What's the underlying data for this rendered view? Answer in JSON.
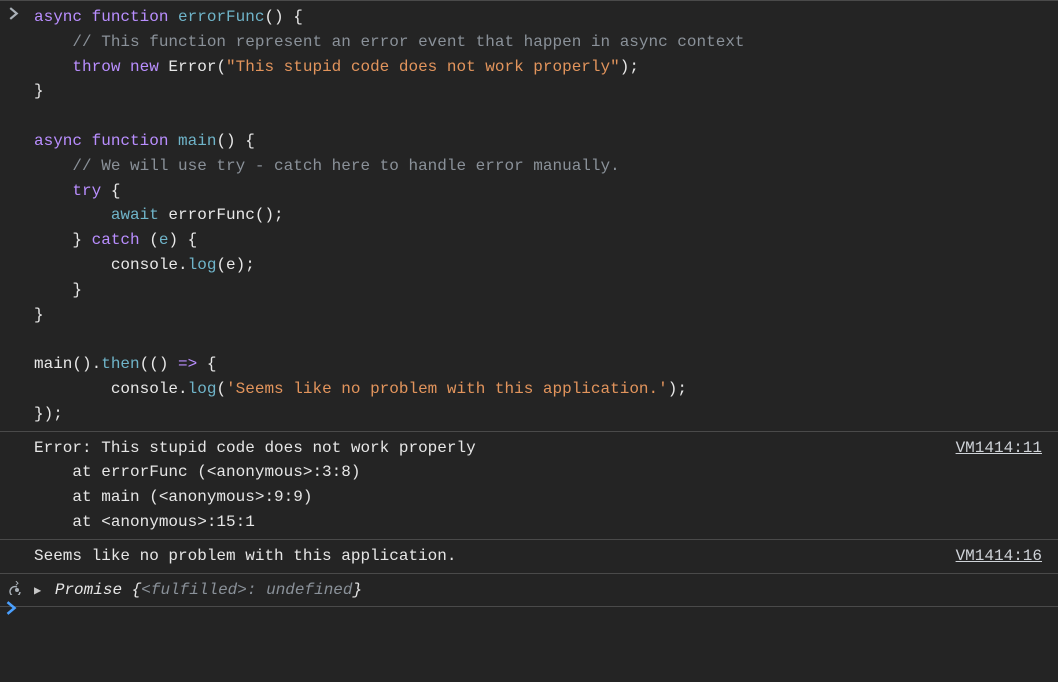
{
  "input": {
    "prompt_icon": "chevron-right",
    "tokens": [
      {
        "t": "async ",
        "c": "kw"
      },
      {
        "t": "function ",
        "c": "kw"
      },
      {
        "t": "errorFunc",
        "c": "fn"
      },
      {
        "t": "() {",
        "c": "plain"
      },
      {
        "t": "\n",
        "c": "nl"
      },
      {
        "t": "    // This function represent an error event that happen in async context",
        "c": "cmt"
      },
      {
        "t": "\n",
        "c": "nl"
      },
      {
        "t": "    ",
        "c": "plain"
      },
      {
        "t": "throw ",
        "c": "kw"
      },
      {
        "t": "new ",
        "c": "kw"
      },
      {
        "t": "Error",
        "c": "type"
      },
      {
        "t": "(",
        "c": "plain"
      },
      {
        "t": "\"This stupid code does not work properly\"",
        "c": "str"
      },
      {
        "t": ");",
        "c": "plain"
      },
      {
        "t": "\n",
        "c": "nl"
      },
      {
        "t": "}",
        "c": "plain"
      },
      {
        "t": "\n",
        "c": "nl"
      },
      {
        "t": "\n",
        "c": "nl"
      },
      {
        "t": "async ",
        "c": "kw"
      },
      {
        "t": "function ",
        "c": "kw"
      },
      {
        "t": "main",
        "c": "fn"
      },
      {
        "t": "() {",
        "c": "plain"
      },
      {
        "t": "\n",
        "c": "nl"
      },
      {
        "t": "    // We will use try - catch here to handle error manually.",
        "c": "cmt"
      },
      {
        "t": "\n",
        "c": "nl"
      },
      {
        "t": "    ",
        "c": "plain"
      },
      {
        "t": "try ",
        "c": "kw"
      },
      {
        "t": "{",
        "c": "plain"
      },
      {
        "t": "\n",
        "c": "nl"
      },
      {
        "t": "        ",
        "c": "plain"
      },
      {
        "t": "await ",
        "c": "await"
      },
      {
        "t": "errorFunc();",
        "c": "plain"
      },
      {
        "t": "\n",
        "c": "nl"
      },
      {
        "t": "    } ",
        "c": "plain"
      },
      {
        "t": "catch ",
        "c": "kw"
      },
      {
        "t": "(",
        "c": "plain"
      },
      {
        "t": "e",
        "c": "fn"
      },
      {
        "t": ") {",
        "c": "plain"
      },
      {
        "t": "\n",
        "c": "nl"
      },
      {
        "t": "        console.",
        "c": "plain"
      },
      {
        "t": "log",
        "c": "prop"
      },
      {
        "t": "(e);",
        "c": "plain"
      },
      {
        "t": "\n",
        "c": "nl"
      },
      {
        "t": "    }",
        "c": "plain"
      },
      {
        "t": "\n",
        "c": "nl"
      },
      {
        "t": "}",
        "c": "plain"
      },
      {
        "t": "\n",
        "c": "nl"
      },
      {
        "t": "\n",
        "c": "nl"
      },
      {
        "t": "main().",
        "c": "plain"
      },
      {
        "t": "then",
        "c": "prop"
      },
      {
        "t": "(() ",
        "c": "plain"
      },
      {
        "t": "=>",
        "c": "kw"
      },
      {
        "t": " {",
        "c": "plain"
      },
      {
        "t": "\n",
        "c": "nl"
      },
      {
        "t": "        console.",
        "c": "plain"
      },
      {
        "t": "log",
        "c": "prop"
      },
      {
        "t": "(",
        "c": "plain"
      },
      {
        "t": "'Seems like no problem with this application.'",
        "c": "str"
      },
      {
        "t": ");",
        "c": "plain"
      },
      {
        "t": "\n",
        "c": "nl"
      },
      {
        "t": "});",
        "c": "plain"
      }
    ]
  },
  "error_log": {
    "lines": [
      "Error: This stupid code does not work properly",
      "    at errorFunc (<anonymous>:3:8)",
      "    at main (<anonymous>:9:9)",
      "    at <anonymous>:15:1"
    ],
    "source_link": "VM1414:11"
  },
  "info_log": {
    "text": "Seems like no problem with this application.",
    "source_link": "VM1414:16"
  },
  "result": {
    "icon": "return-arrow",
    "object_name": "Promise ",
    "open": "{",
    "state": "<fulfilled>",
    "sep": ": ",
    "value": "undefined",
    "close": "}"
  },
  "prompt": {
    "caret_color": "#4aa0ff"
  }
}
